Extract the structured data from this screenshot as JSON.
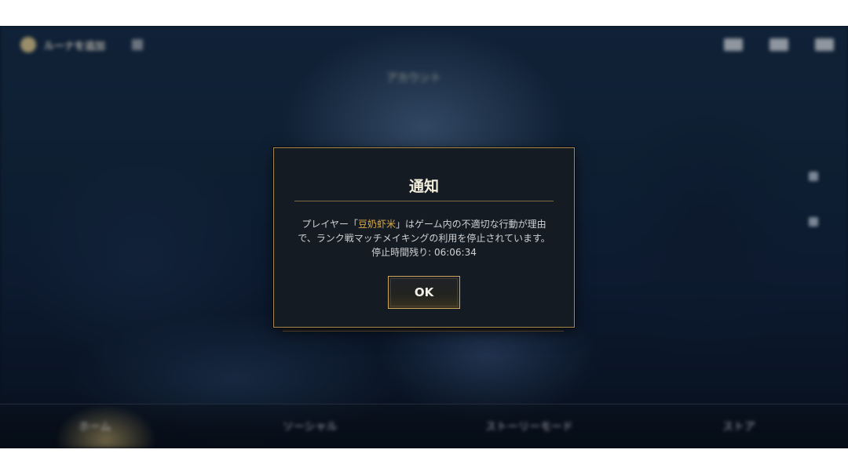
{
  "background": {
    "top_left_label": "ルーナを追加",
    "heading": "アカウント",
    "nav_items": [
      "ホーム",
      "ソーシャル",
      "ストーリーモード",
      "ストア"
    ]
  },
  "dialog": {
    "title": "通知",
    "body_line1_prefix": "プレイヤー「",
    "player_name": "豆奶虾米",
    "body_line1_suffix": "」はゲーム内の不適切な行動が理由",
    "body_line2": "で、ランク戦マッチメイキングの利用を停止されています。",
    "body_line3_label": "停止時間残り: ",
    "remaining_time": "06:06:34",
    "ok_label": "OK"
  },
  "colors": {
    "accent_gold": "#d8a94a",
    "border_gold": "#a88a4c",
    "dialog_bg": "#141b22"
  },
  "icons": [
    "coin-icon",
    "mail-icon",
    "chat-icon",
    "settings-icon"
  ]
}
